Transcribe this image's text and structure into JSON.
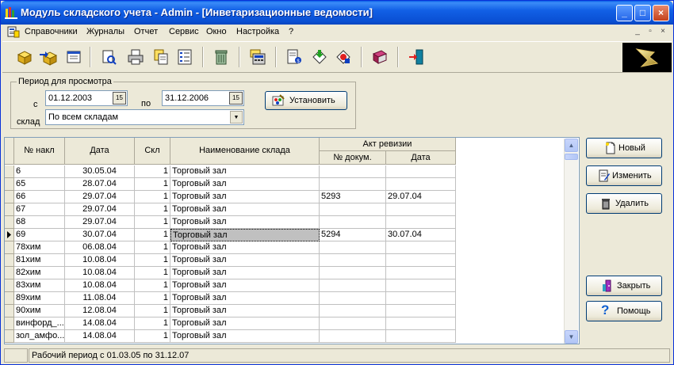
{
  "window": {
    "title": "Модуль складского учета - Admin - [Инветаризационные ведомости]",
    "minimize": "_",
    "maximize": "□",
    "close": "×"
  },
  "menu": {
    "items": [
      "Справочники",
      "Журналы",
      "Отчет",
      "Сервис",
      "Окно",
      "Настройка",
      "?"
    ],
    "mdi": [
      "_",
      "▫",
      "×"
    ]
  },
  "toolbar": {
    "icons": [
      "box-icon",
      "box-arrow-icon",
      "notepad-icon",
      "print-preview-icon",
      "printer-icon",
      "copy-icon",
      "list-icon",
      "trash-icon",
      "calculator-icon",
      "document-edit-icon",
      "tag-green-icon",
      "tag-red-icon",
      "book-icon",
      "exit-door-icon"
    ]
  },
  "filter": {
    "group_title": "Период для просмотра",
    "from_label": "с",
    "from_value": "01.12.2003",
    "to_label": "по",
    "to_value": "31.12.2006",
    "calendar_glyph": "15",
    "warehouse_label": "склад",
    "warehouse_value": "По всем складам",
    "apply_label": "Установить"
  },
  "grid": {
    "headers": {
      "num": "№ накл",
      "date": "Дата",
      "skl": "Скл",
      "name": "Наименование склада",
      "act_group": "Акт ревизии",
      "act_doc": "№ докум.",
      "act_date": "Дата"
    },
    "rows": [
      {
        "num": "6",
        "date": "30.05.04",
        "skl": "1",
        "name": "Торговый зал",
        "act_doc": "",
        "act_date": ""
      },
      {
        "num": "65",
        "date": "28.07.04",
        "skl": "1",
        "name": "Торговый зал",
        "act_doc": "",
        "act_date": ""
      },
      {
        "num": "66",
        "date": "29.07.04",
        "skl": "1",
        "name": "Торговый зал",
        "act_doc": "5293",
        "act_date": "29.07.04"
      },
      {
        "num": "67",
        "date": "29.07.04",
        "skl": "1",
        "name": "Торговый зал",
        "act_doc": "",
        "act_date": ""
      },
      {
        "num": "68",
        "date": "29.07.04",
        "skl": "1",
        "name": "Торговый зал",
        "act_doc": "",
        "act_date": ""
      },
      {
        "num": "69",
        "date": "30.07.04",
        "skl": "1",
        "name": "Торговый зал",
        "act_doc": "5294",
        "act_date": "30.07.04"
      },
      {
        "num": "78хим",
        "date": "06.08.04",
        "skl": "1",
        "name": "Торговый зал",
        "act_doc": "",
        "act_date": ""
      },
      {
        "num": "81хим",
        "date": "10.08.04",
        "skl": "1",
        "name": "Торговый зал",
        "act_doc": "",
        "act_date": ""
      },
      {
        "num": "82хим",
        "date": "10.08.04",
        "skl": "1",
        "name": "Торговый зал",
        "act_doc": "",
        "act_date": ""
      },
      {
        "num": "83хим",
        "date": "10.08.04",
        "skl": "1",
        "name": "Торговый зал",
        "act_doc": "",
        "act_date": ""
      },
      {
        "num": "89хим",
        "date": "11.08.04",
        "skl": "1",
        "name": "Торговый зал",
        "act_doc": "",
        "act_date": ""
      },
      {
        "num": "90хим",
        "date": "12.08.04",
        "skl": "1",
        "name": "Торговый зал",
        "act_doc": "",
        "act_date": ""
      },
      {
        "num": "винфорд_...",
        "date": "14.08.04",
        "skl": "1",
        "name": "Торговый зал",
        "act_doc": "",
        "act_date": ""
      },
      {
        "num": "зол_амфо...",
        "date": "14.08.04",
        "skl": "1",
        "name": "Торговый зал",
        "act_doc": "",
        "act_date": ""
      }
    ],
    "selected_row": 5
  },
  "actions": {
    "new": "Новый",
    "edit": "Изменить",
    "delete": "Удалить",
    "close": "Закрыть",
    "help": "Помощь"
  },
  "status": {
    "pane1": "",
    "pane2": "Рабочий период с 01.03.05 по 31.12.07"
  },
  "colors": {
    "titlebar": "#0a50d4",
    "window_bg": "#ece9d8",
    "selection": "#c0c0c0"
  }
}
